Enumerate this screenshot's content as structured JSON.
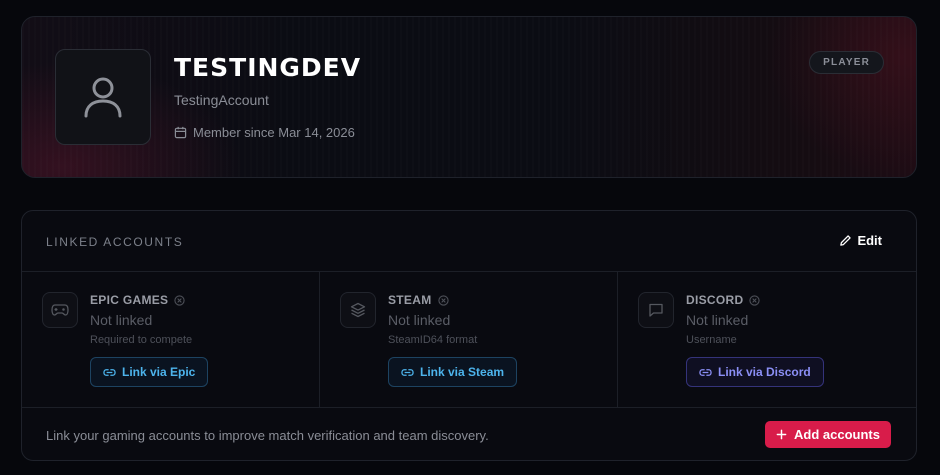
{
  "profile": {
    "display_name": "TESTINGDEV",
    "username": "TestingAccount",
    "member_since": "Member since Mar 14, 2026",
    "role_badge": "PLAYER",
    "avatar_icon": "user-icon"
  },
  "linked_accounts": {
    "title": "LINKED ACCOUNTS",
    "edit_label": "Edit",
    "accounts": [
      {
        "name": "EPIC GAMES",
        "icon": "gamepad-icon",
        "status": "Not linked",
        "hint": "Required to compete",
        "button_label": "Link via Epic",
        "accent": "#4db4ec"
      },
      {
        "name": "STEAM",
        "icon": "layers-icon",
        "status": "Not linked",
        "hint": "SteamID64 format",
        "button_label": "Link via Steam",
        "accent": "#4db4ec"
      },
      {
        "name": "DISCORD",
        "icon": "chat-icon",
        "status": "Not linked",
        "hint": "Username",
        "button_label": "Link via Discord",
        "accent": "#8b8ff5"
      }
    ],
    "footer_text": "Link your gaming accounts to improve match verification and team discovery.",
    "add_button_label": "Add accounts",
    "add_button_color": "#d81c4a"
  }
}
